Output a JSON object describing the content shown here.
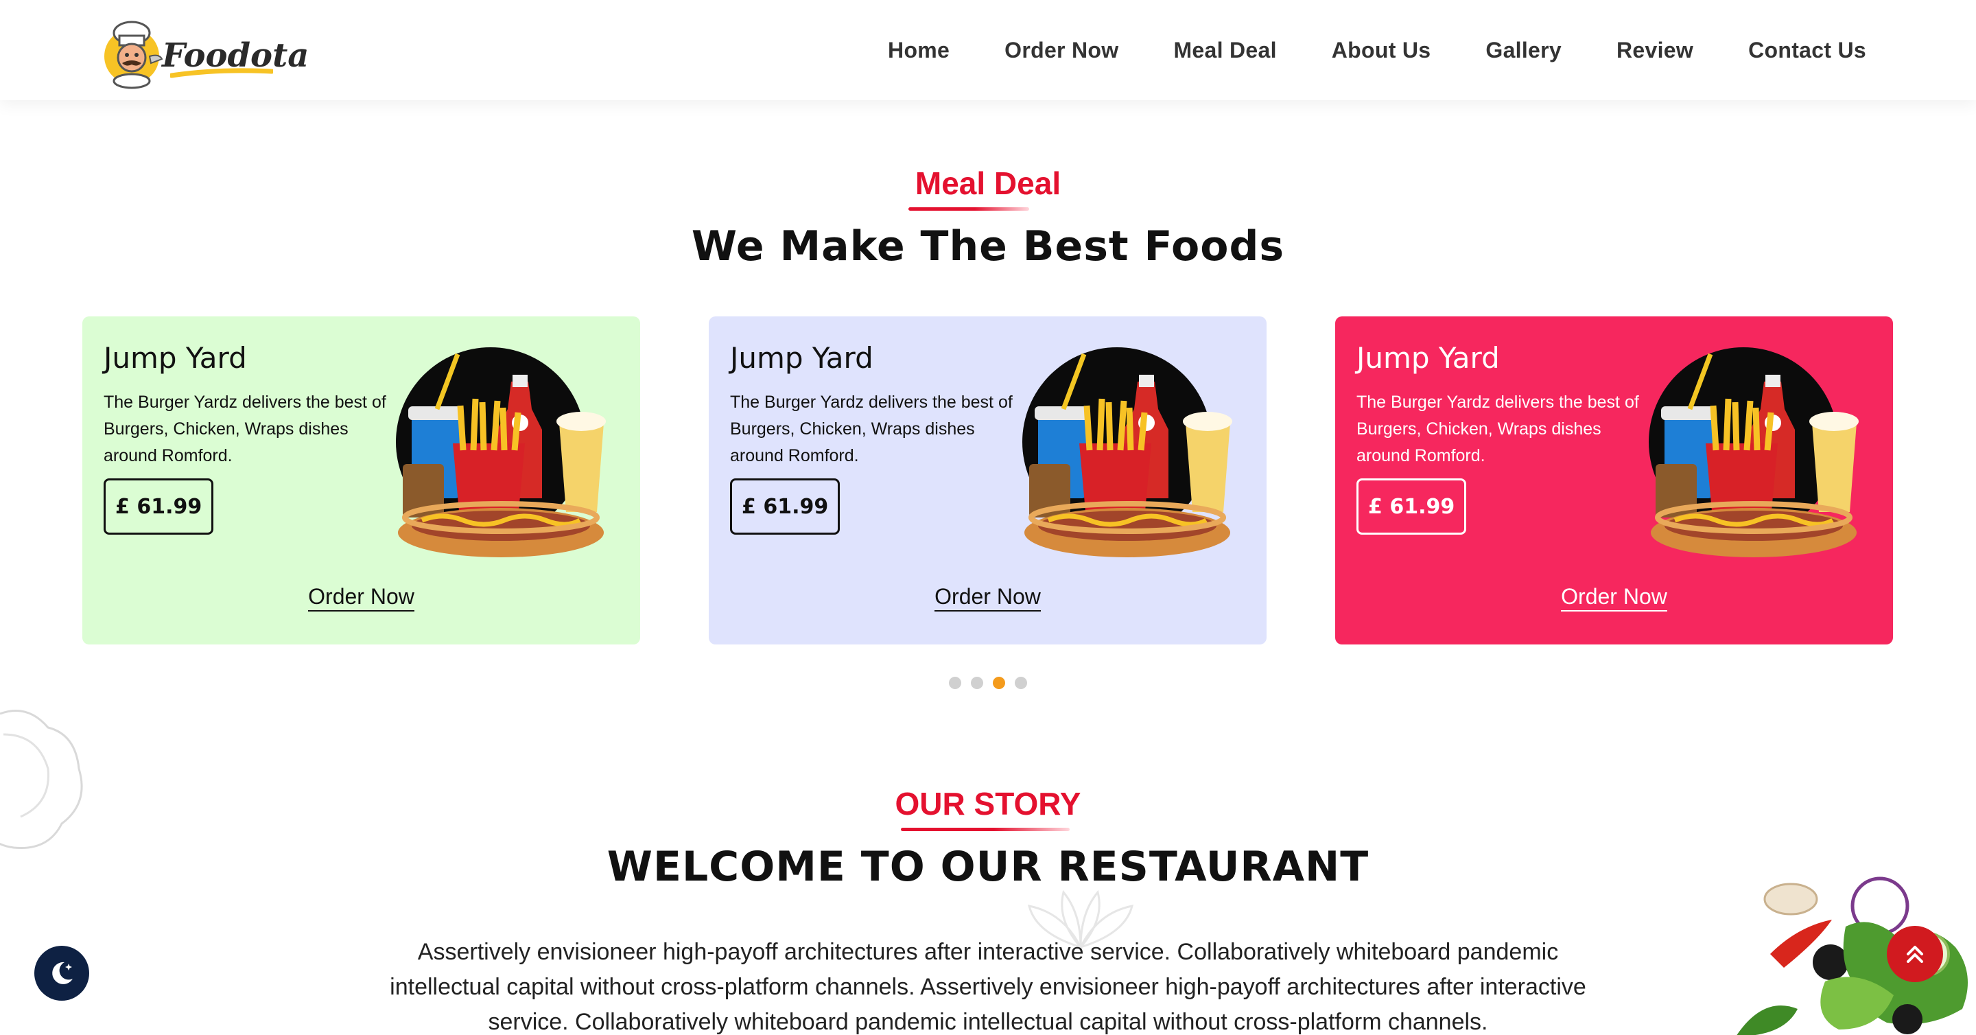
{
  "header": {
    "logo_text": "Foodota",
    "nav": [
      "Home",
      "Order Now",
      "Meal Deal",
      "About Us",
      "Gallery",
      "Review",
      "Contact Us"
    ]
  },
  "meal_deal": {
    "subtitle": "Meal Deal",
    "title": "We Make The Best Foods",
    "cards": [
      {
        "title": "Jump Yard",
        "description": "The Burger Yardz delivers the best of Burgers, Chicken, Wraps dishes around Romford.",
        "price": "£ 61.99",
        "cta": "Order Now",
        "background": "#dbfdd3"
      },
      {
        "title": "Jump Yard",
        "description": "The Burger Yardz delivers the best of Burgers, Chicken, Wraps dishes around Romford.",
        "price": "£ 61.99",
        "cta": "Order Now",
        "background": "#dfe3fd"
      },
      {
        "title": "Jump Yard",
        "description": "The Burger Yardz delivers the best of Burgers, Chicken, Wraps dishes around Romford.",
        "price": "£ 61.99",
        "cta": "Order Now",
        "background": "#f6275e"
      }
    ],
    "slider": {
      "total_dots": 4,
      "active_dot": 3
    }
  },
  "story": {
    "subtitle": "OUR STORY",
    "title": "WELCOME TO OUR RESTAURANT",
    "paragraph": "Assertively envisioneer high-payoff architectures after interactive service. Collaboratively whiteboard pandemic intellectual capital without cross-platform channels. Assertively envisioneer high-payoff architectures after interactive service. Collaboratively whiteboard pandemic intellectual capital without cross-platform channels."
  },
  "floating": {
    "dark_mode_icon": "moon-stars-icon",
    "scroll_top_icon": "double-chevron-up-icon"
  },
  "colors": {
    "accent_red": "#e4112f",
    "active_dot": "#f49b1c",
    "dark_toggle": "#0e2143",
    "scroll_top": "#d11a1f"
  }
}
